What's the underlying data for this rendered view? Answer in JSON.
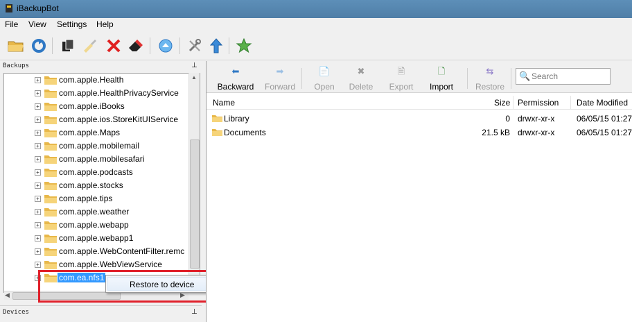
{
  "window": {
    "title": "iBackupBot"
  },
  "menubar": {
    "items": [
      "File",
      "View",
      "Settings",
      "Help"
    ]
  },
  "toolbar": {
    "icons": [
      "open-folder-icon",
      "refresh-icon",
      "copy-icon",
      "clean-brush-icon",
      "delete-icon",
      "eraser-icon",
      "upload-icon",
      "tools-icon",
      "export-arrow-icon",
      "favorite-star-icon"
    ]
  },
  "left_panel": {
    "backups_header": "Backups",
    "devices_header": "Devices",
    "tree_items": [
      "com.apple.Health",
      "com.apple.HealthPrivacyService",
      "com.apple.iBooks",
      "com.apple.ios.StoreKitUIService",
      "com.apple.Maps",
      "com.apple.mobilemail",
      "com.apple.mobilesafari",
      "com.apple.podcasts",
      "com.apple.stocks",
      "com.apple.tips",
      "com.apple.weather",
      "com.apple.webapp",
      "com.apple.webapp1",
      "com.apple.WebContentFilter.remc",
      "com.apple.WebViewService",
      "com.ea.nfs1"
    ],
    "selected_item": "com.ea.nfs1"
  },
  "context_menu": {
    "items": [
      "Restore to device"
    ]
  },
  "right_panel": {
    "toolbar": {
      "backward": "Backward",
      "forward": "Forward",
      "open": "Open",
      "delete": "Delete",
      "export": "Export",
      "import": "Import",
      "restore": "Restore"
    },
    "search": {
      "placeholder": "Search"
    },
    "columns": [
      "Name",
      "Size",
      "Permission",
      "Date Modified"
    ],
    "files": [
      {
        "name": "Library",
        "size": "0",
        "permission": "drwxr-xr-x",
        "date": "06/05/15 01:27"
      },
      {
        "name": "Documents",
        "size": "21.5 kB",
        "permission": "drwxr-xr-x",
        "date": "06/05/15 01:27"
      }
    ]
  },
  "colors": {
    "selection": "#3399ff",
    "highlight_box": "#e0202a",
    "folder": "#e8b84a"
  }
}
